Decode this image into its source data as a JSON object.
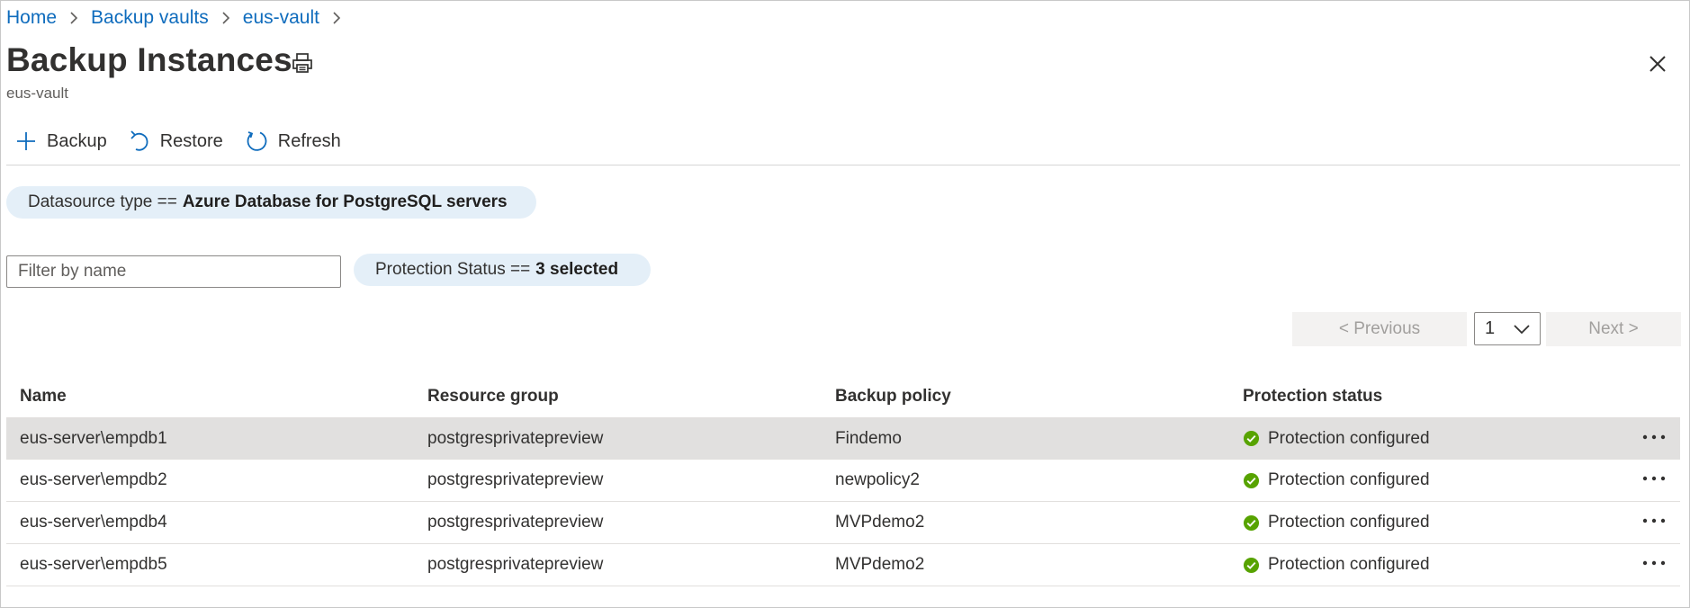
{
  "breadcrumb": {
    "items": [
      "Home",
      "Backup vaults",
      "eus-vault"
    ]
  },
  "header": {
    "title": "Backup Instances",
    "subtitle": "eus-vault"
  },
  "toolbar": {
    "backup_label": "Backup",
    "restore_label": "Restore",
    "refresh_label": "Refresh"
  },
  "filters": {
    "datasource_prefix": "Datasource type ==",
    "datasource_value": "Azure Database for PostgreSQL servers",
    "name_placeholder": "Filter by name",
    "name_value": "",
    "protection_prefix": "Protection Status ==",
    "protection_value": "3 selected"
  },
  "pagination": {
    "previous_label": "< Previous",
    "page": "1",
    "next_label": "Next >"
  },
  "table": {
    "columns": [
      "Name",
      "Resource group",
      "Backup policy",
      "Protection status"
    ],
    "rows": [
      {
        "name": "eus-server\\empdb1",
        "resource_group": "postgresprivatepreview",
        "policy": "Findemo",
        "status": "Protection configured"
      },
      {
        "name": "eus-server\\empdb2",
        "resource_group": "postgresprivatepreview",
        "policy": "newpolicy2",
        "status": "Protection configured"
      },
      {
        "name": "eus-server\\empdb4",
        "resource_group": "postgresprivatepreview",
        "policy": "MVPdemo2",
        "status": "Protection configured"
      },
      {
        "name": "eus-server\\empdb5",
        "resource_group": "postgresprivatepreview",
        "policy": "MVPdemo2",
        "status": "Protection configured"
      }
    ]
  },
  "colors": {
    "link": "#0f6cbd",
    "pill_bg": "#e4eff8",
    "status_success": "#57a300",
    "selected_row": "#e1e0df"
  },
  "icons": {
    "print": "print-icon",
    "close": "close-icon",
    "backup": "plus-icon",
    "restore": "undo-icon",
    "refresh": "refresh-icon",
    "status": "check-circle-icon",
    "more": "more-ellipsis-icon",
    "dropdown": "chevron-down-icon"
  }
}
